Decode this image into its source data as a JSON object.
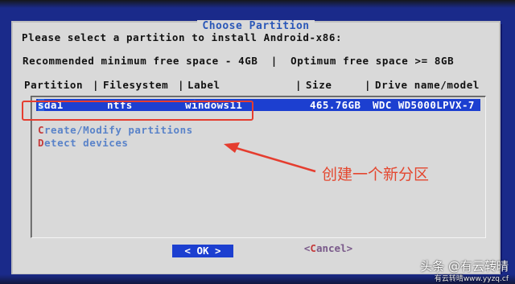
{
  "dialog": {
    "title": "Choose Partition",
    "instruction": "Please select a partition to install Android-x86:",
    "space_info": "Recommended minimum free space - 4GB  |  Optimum free space >= 8GB"
  },
  "columns": {
    "partition": "Partition",
    "sep1": "|",
    "filesystem": "Filesystem",
    "sep2": "|",
    "label": "Label",
    "sep3": "|",
    "size": "Size",
    "sep4": "|",
    "drive": "Drive name/model"
  },
  "partitions": [
    {
      "cursor": "s",
      "partition_rest": "da1",
      "filesystem": "ntfs",
      "label": "windows11",
      "size": "465.76GB",
      "drive": "WDC WD5000LPVX-7"
    }
  ],
  "menu": {
    "create_first": "C",
    "create_rest": "reate/Modify partitions",
    "detect_first": "D",
    "detect_rest": "etect devices"
  },
  "buttons": {
    "ok": "< OK >",
    "cancel_open": "<",
    "cancel_hot": "C",
    "cancel_rest": "ancel>"
  },
  "annotation": {
    "text": "创建一个新分区",
    "color": "#e4472f"
  },
  "watermark": {
    "main": "头条 @有云转晴",
    "sub": "有云转晴www.yyzq.cf"
  },
  "colors": {
    "background": "#1a2a8a",
    "dialog": "#d9d9d9",
    "selection": "#1c3fd0",
    "title": "#2a57b8"
  }
}
